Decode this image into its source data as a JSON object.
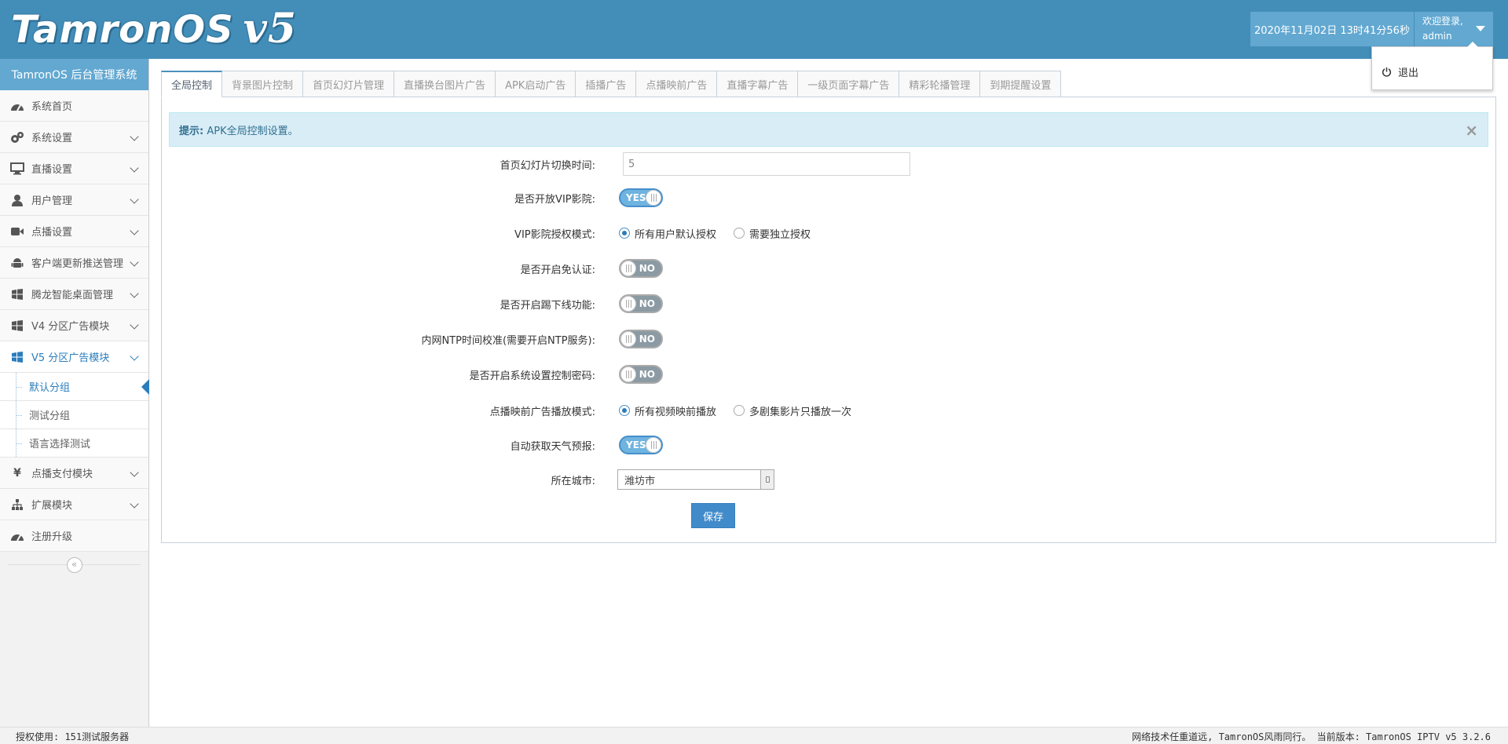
{
  "header": {
    "brand": "TamronOS",
    "version": "v5",
    "datetime": "2020年11月02日 13时41分56秒",
    "welcome": "欢迎登录,",
    "username": "admin",
    "menu_logout": "退出"
  },
  "sidebar": {
    "title": "TamronOS 后台管理系统",
    "items": [
      {
        "label": "系统首页",
        "icon": "dashboard-icon"
      },
      {
        "label": "系统设置",
        "icon": "gears-icon"
      },
      {
        "label": "直播设置",
        "icon": "desktop-icon"
      },
      {
        "label": "用户管理",
        "icon": "user-icon"
      },
      {
        "label": "点播设置",
        "icon": "video-camera-icon"
      },
      {
        "label": "客户端更新推送管理",
        "icon": "android-icon"
      },
      {
        "label": "腾龙智能桌面管理",
        "icon": "windows-icon"
      },
      {
        "label": "V4 分区广告模块",
        "icon": "windows-icon"
      },
      {
        "label": "V5 分区广告模块",
        "icon": "windows-icon"
      },
      {
        "label": "点播支付模块",
        "icon": "yen-icon"
      },
      {
        "label": "扩展模块",
        "icon": "sitemap-icon"
      },
      {
        "label": "注册升级",
        "icon": "dashboard-icon"
      }
    ],
    "subitems": [
      "默认分组",
      "测试分组",
      "语言选择测试"
    ],
    "collapse": "«"
  },
  "tabs": [
    "全局控制",
    "背景图片控制",
    "首页幻灯片管理",
    "直播换台图片广告",
    "APK启动广告",
    "插播广告",
    "点播映前广告",
    "直播字幕广告",
    "一级页面字幕广告",
    "精彩轮播管理",
    "到期提醒设置"
  ],
  "alert": {
    "prefix": "提示:",
    "text": "APK全局控制设置。",
    "close": "×"
  },
  "form": {
    "slide_interval": {
      "label": "首页幻灯片切换时间:",
      "value": "5"
    },
    "vip_open": {
      "label": "是否开放VIP影院:",
      "state": "YES"
    },
    "vip_mode": {
      "label": "VIP影院授权模式:",
      "options": [
        "所有用户默认授权",
        "需要独立授权"
      ],
      "selected": 0
    },
    "free_auth": {
      "label": "是否开启免认证:",
      "state": "NO"
    },
    "kick_offline": {
      "label": "是否开启踢下线功能:",
      "state": "NO"
    },
    "ntp": {
      "label": "内网NTP时间校准(需要开启NTP服务):",
      "state": "NO"
    },
    "sys_password": {
      "label": "是否开启系统设置控制密码:",
      "state": "NO"
    },
    "preroll_mode": {
      "label": "点播映前广告播放模式:",
      "options": [
        "所有视频映前播放",
        "多剧集影片只播放一次"
      ],
      "selected": 0
    },
    "weather": {
      "label": "自动获取天气预报:",
      "state": "YES"
    },
    "city": {
      "label": "所在城市:",
      "value": "潍坊市"
    },
    "save": "保存"
  },
  "footer": {
    "left": "授权使用: 151测试服务器",
    "right": "网络技术任重道远, TamronOS风雨同行。 当前版本: TamronOS IPTV v5 3.2.6"
  },
  "colors": {
    "header_bg": "#438eb9",
    "accent": "#2b7dbc",
    "toggle_on": "#6fb3e0",
    "toggle_off": "#8b9aa3",
    "alert_bg": "#d9edf7"
  }
}
